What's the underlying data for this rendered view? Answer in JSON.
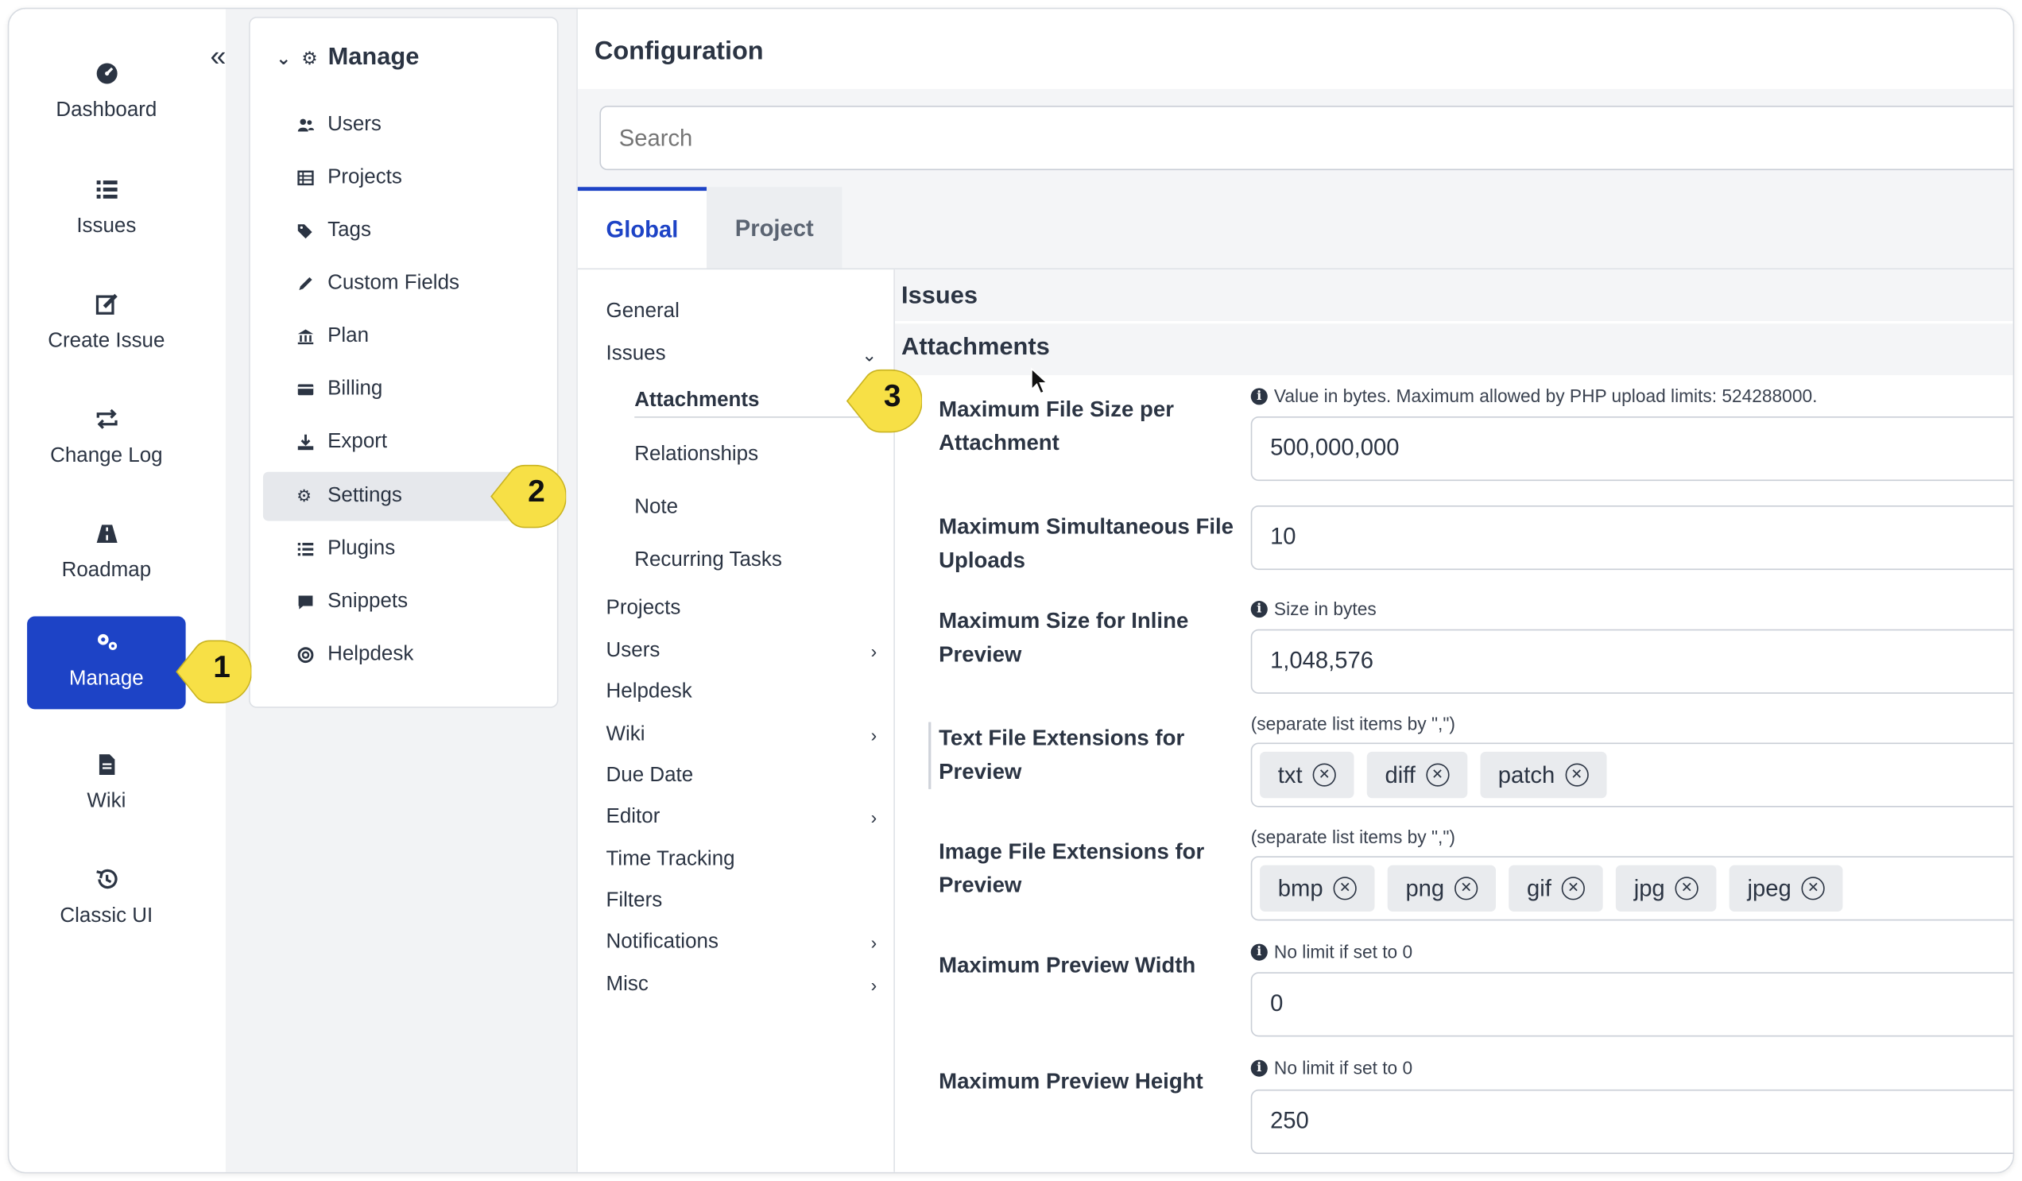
{
  "leftnav": {
    "collapse_icon": "double-chevron-left-icon",
    "items": [
      {
        "label": "Dashboard",
        "icon": "dashboard-icon"
      },
      {
        "label": "Issues",
        "icon": "list-icon"
      },
      {
        "label": "Create Issue",
        "icon": "edit-icon"
      },
      {
        "label": "Change Log",
        "icon": "swap-icon"
      },
      {
        "label": "Roadmap",
        "icon": "road-icon"
      },
      {
        "label": "Manage",
        "icon": "cogs-icon"
      },
      {
        "label": "Wiki",
        "icon": "document-icon"
      },
      {
        "label": "Classic UI",
        "icon": "history-icon"
      }
    ]
  },
  "callouts": [
    "1",
    "2",
    "3"
  ],
  "manage": {
    "title": "Manage",
    "items": [
      {
        "label": "Users"
      },
      {
        "label": "Projects"
      },
      {
        "label": "Tags"
      },
      {
        "label": "Custom Fields"
      },
      {
        "label": "Plan"
      },
      {
        "label": "Billing"
      },
      {
        "label": "Export"
      },
      {
        "label": "Settings"
      },
      {
        "label": "Plugins"
      },
      {
        "label": "Snippets"
      },
      {
        "label": "Helpdesk"
      }
    ]
  },
  "config": {
    "title": "Configuration",
    "search_placeholder": "Search",
    "tabs": [
      "Global",
      "Project"
    ],
    "tree": {
      "general": "General",
      "issues": "Issues",
      "attachments": "Attachments",
      "relationships": "Relationships",
      "note": "Note",
      "recurring": "Recurring Tasks",
      "projects": "Projects",
      "users": "Users",
      "helpdesk": "Helpdesk",
      "wiki": "Wiki",
      "due_date": "Due Date",
      "editor": "Editor",
      "time_tracking": "Time Tracking",
      "filters": "Filters",
      "notifications": "Notifications",
      "misc": "Misc"
    },
    "section_issues": "Issues",
    "section_attachments": "Attachments",
    "fields": {
      "max_file_size": {
        "label": "Maximum File Size per Attachment",
        "hint": "Value in bytes. Maximum allowed by PHP upload limits: 524288000.",
        "value": "500,000,000"
      },
      "max_uploads": {
        "label": "Maximum Simultaneous File Uploads",
        "value": "10"
      },
      "max_inline": {
        "label": "Maximum Size for Inline Preview",
        "hint": "Size in bytes",
        "value": "1,048,576"
      },
      "text_ext": {
        "label": "Text File Extensions for Preview",
        "hint": "(separate list items by \",\")",
        "tags": [
          "txt",
          "diff",
          "patch"
        ]
      },
      "image_ext": {
        "label": "Image File Extensions for Preview",
        "hint": "(separate list items by \",\")",
        "tags": [
          "bmp",
          "png",
          "gif",
          "jpg",
          "jpeg"
        ]
      },
      "preview_width": {
        "label": "Maximum Preview Width",
        "hint": "No limit if set to 0",
        "value": "0"
      },
      "preview_height": {
        "label": "Maximum Preview Height",
        "hint": "No limit if set to 0",
        "value": "250"
      }
    }
  },
  "colors": {
    "accent": "#1d43c6",
    "callout": "#f7e046",
    "text": "#2b3443"
  }
}
